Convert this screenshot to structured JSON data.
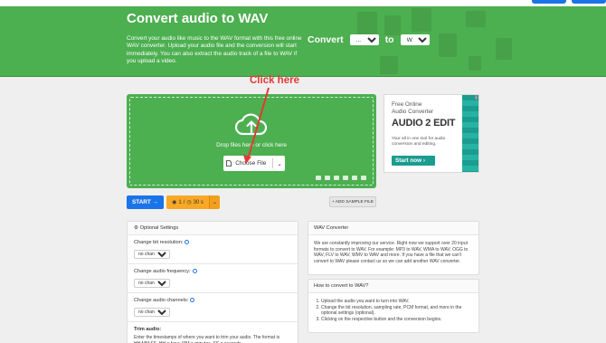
{
  "banner": {
    "title": "Convert audio to WAV",
    "description": "Convert your audio like music to the WAV format with this free online WAV converter. Upload your audio file and the conversion will start immediately. You can also extract the audio track of a file to WAV if you upload a video.",
    "convert_label": "Convert",
    "from_value": "...",
    "to_label": "to",
    "to_value": "WAV"
  },
  "annotation": {
    "text": "Click here",
    "color": "#e53935"
  },
  "upload": {
    "drop_text": "Drop files here or click here",
    "choose_label": "Choose File"
  },
  "ad": {
    "badge": "i",
    "line1": "Free Online",
    "line2": "Audio Converter",
    "brand": "AUDIO 2 EDIT",
    "tagline": "Your all in one tool for audio conversion and editing.",
    "cta": "Start now"
  },
  "actions": {
    "start_label": "START",
    "limit_count": "1",
    "limit_time": "30 s",
    "add_sample": "+ ADD SAMPLE FILE"
  },
  "settings": {
    "header": "Optional Settings",
    "rows": [
      {
        "label": "Change bit resolution:",
        "value": "no change"
      },
      {
        "label": "Change audio frequency:",
        "value": "no change"
      },
      {
        "label": "Change audio channels:",
        "value": "no change"
      }
    ],
    "trim_title": "Trim audio:",
    "trim_text": "Enter the timestamps of where you want to trim your audio. The format is HH:MM:SS. HH = hour, MM = minutes, SS = seconds."
  },
  "wav_panel": {
    "title": "WAV Converter",
    "body": "We are constantly improving our service. Right now we support over 20 input formats to convert to WAV. For example: MP3 to WAV, WMA to WAV, OGG to WAV, FLV to WAV, WMV to WAV and more. If you have a file that we can't convert to WAV please contact us so we can add another WAV converter."
  },
  "howto_panel": {
    "title": "How to convert to WAV?",
    "steps": [
      "Upload the audio you want to turn into WAV.",
      "Change the bit resolution, sampling rate, PCM format, and more in the optional settings (optional).",
      "Clicking on the respective button and the conversion begins."
    ]
  },
  "colors": {
    "brand_green": "#4caf50",
    "start_blue": "#1a73e8",
    "limit_orange": "#f9a825"
  }
}
